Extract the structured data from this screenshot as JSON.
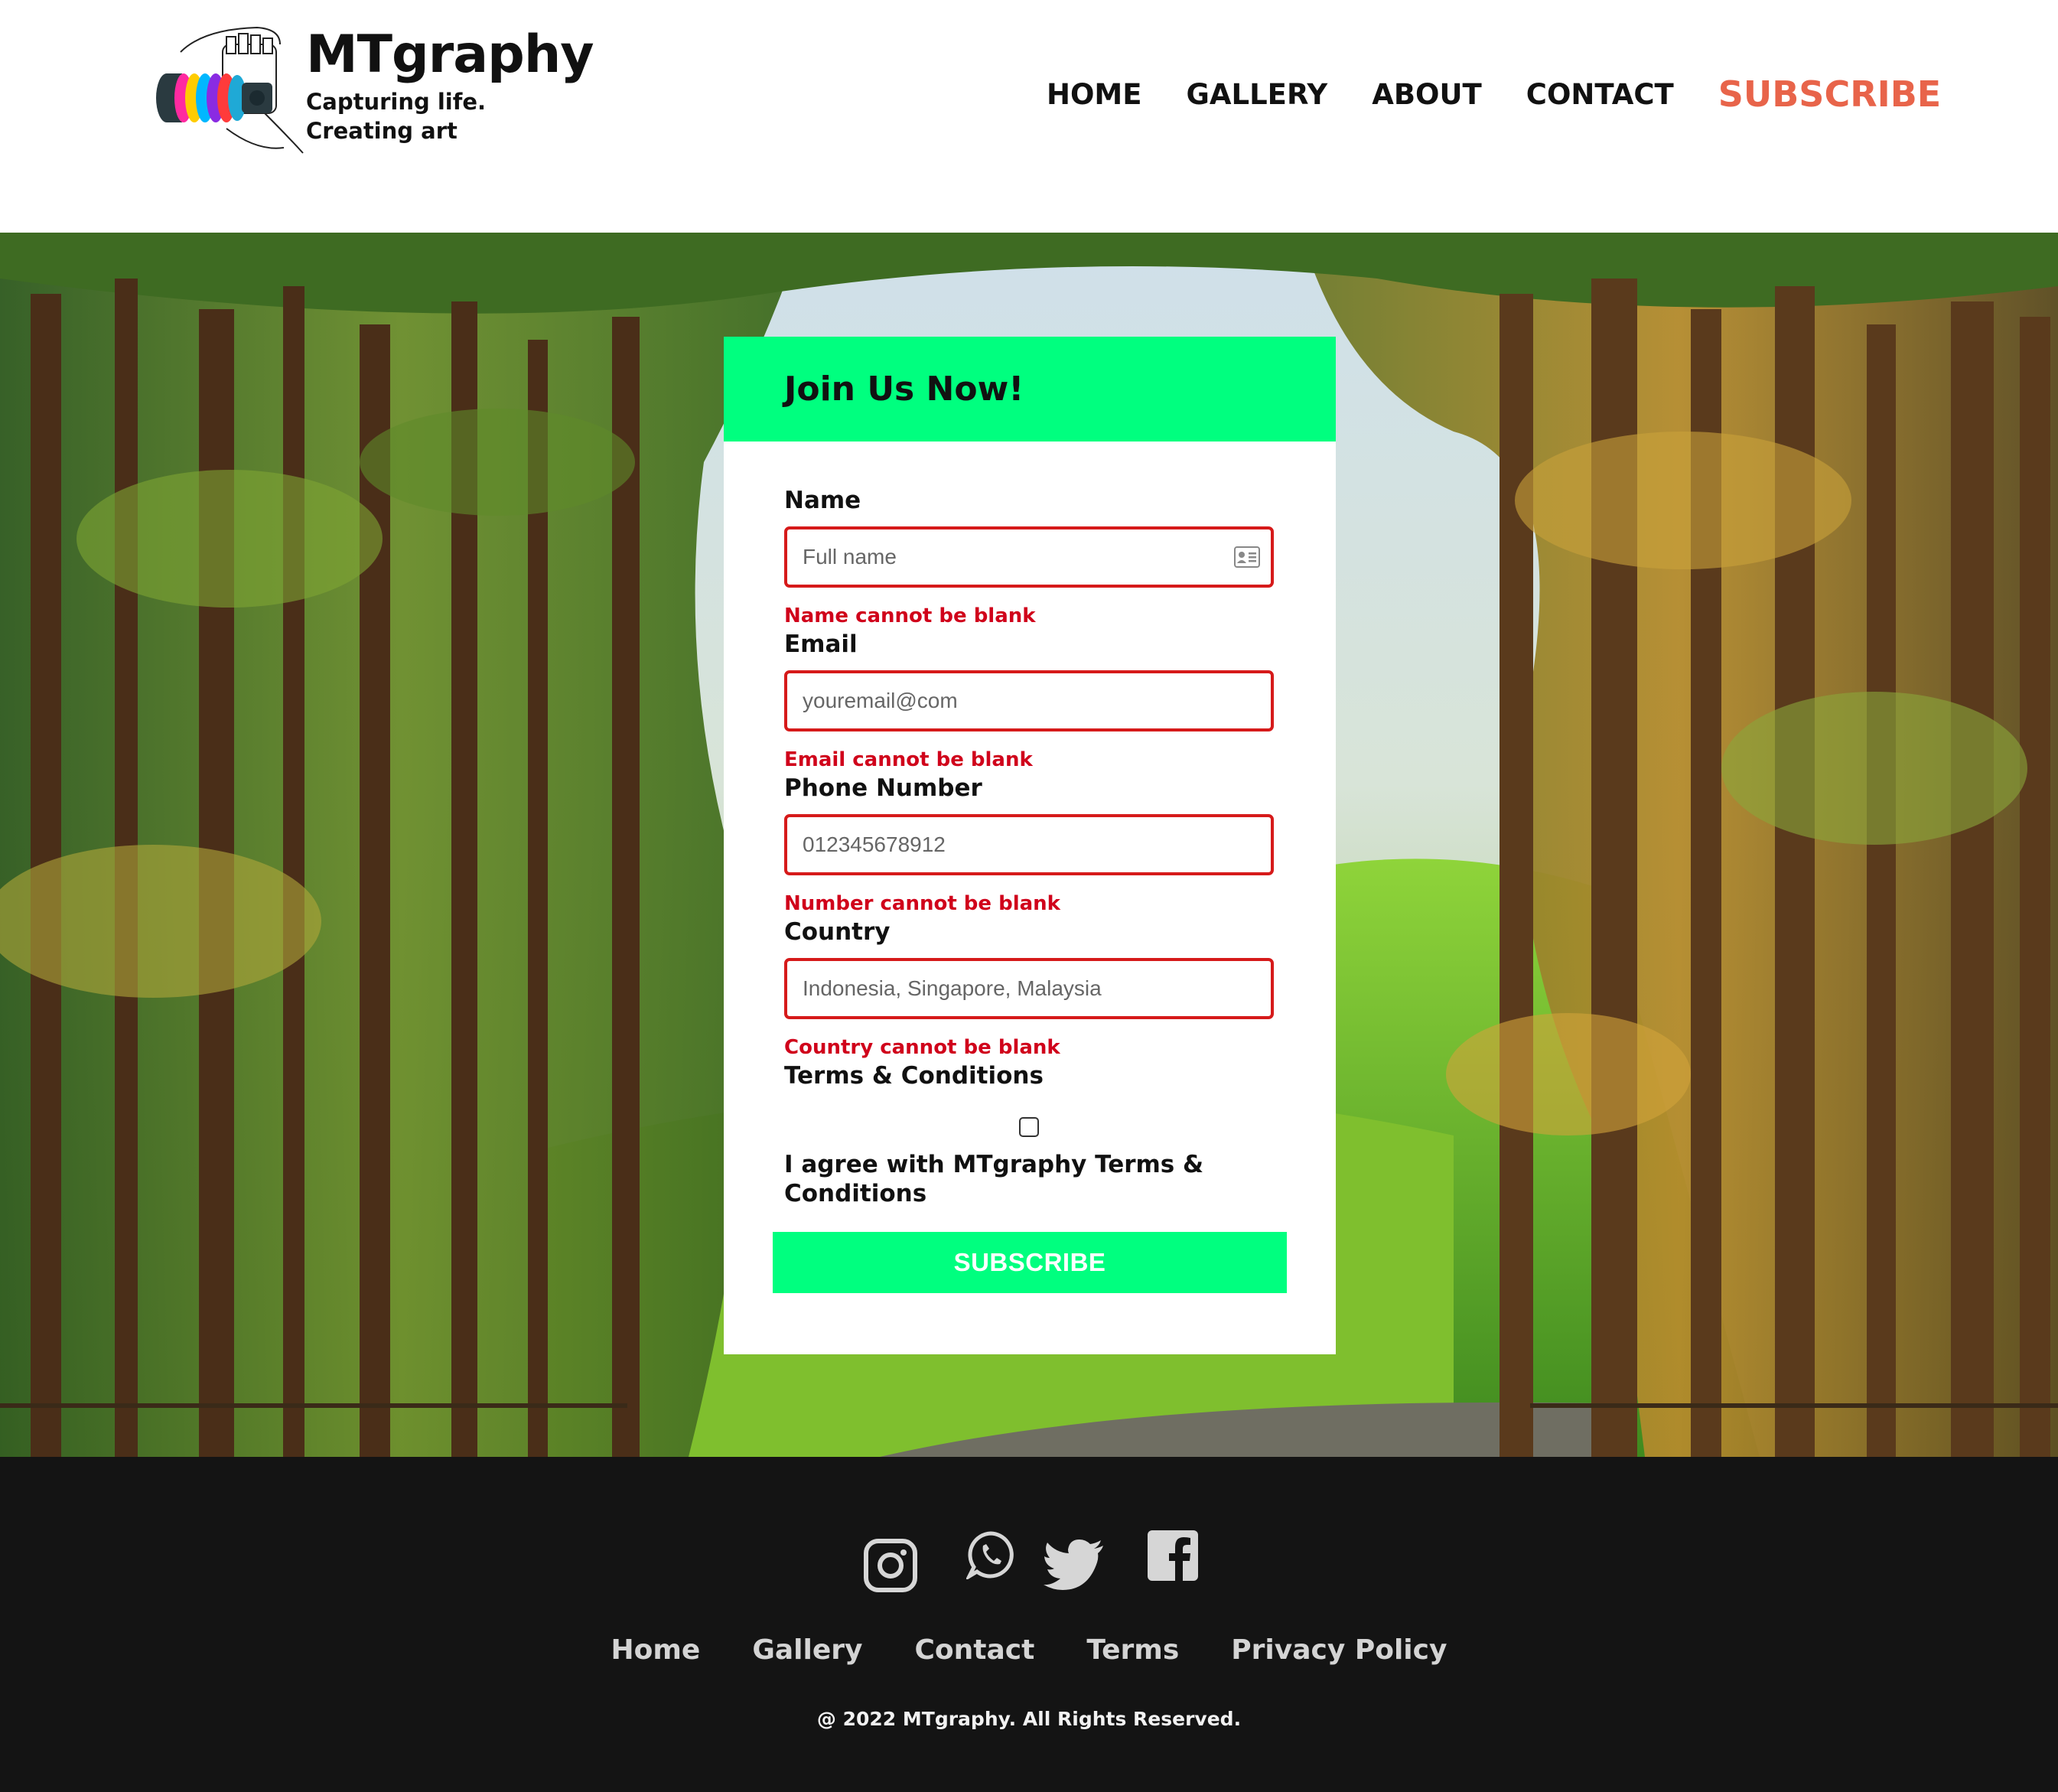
{
  "brand": {
    "name": "MTgraphy",
    "tagline_line1": "Capturing life.",
    "tagline_line2": "Creating art"
  },
  "nav": {
    "items": [
      "HOME",
      "GALLERY",
      "ABOUT",
      "CONTACT"
    ],
    "cta": "SUBSCRIBE",
    "cta_color": "#e8644a"
  },
  "form": {
    "title": "Join Us Now!",
    "fields": [
      {
        "label": "Name",
        "placeholder": "Full name",
        "value": "",
        "error": "Name cannot be blank"
      },
      {
        "label": "Email",
        "placeholder": "youremail@com",
        "value": "",
        "error": "Email cannot be blank"
      },
      {
        "label": "Phone Number",
        "placeholder": "012345678912",
        "value": "",
        "error": "Number cannot be blank"
      },
      {
        "label": "Country",
        "placeholder": "Indonesia, Singapore, Malaysia",
        "value": "",
        "error": "Country cannot be blank"
      }
    ],
    "terms_label": "Terms & Conditions",
    "agree_text": "I agree with MTgraphy Terms & Conditions",
    "agree_checked": false,
    "submit_label": "SUBSCRIBE",
    "accent_color": "#00ff7f",
    "error_color": "#d0021b"
  },
  "footer": {
    "social_icons": [
      "instagram-icon",
      "whatsapp-icon",
      "twitter-icon",
      "facebook-icon"
    ],
    "links": [
      "Home",
      "Gallery",
      "Contact",
      "Terms",
      "Privacy Policy"
    ],
    "copyright": "@ 2022 MTgraphy. All Rights Reserved."
  }
}
